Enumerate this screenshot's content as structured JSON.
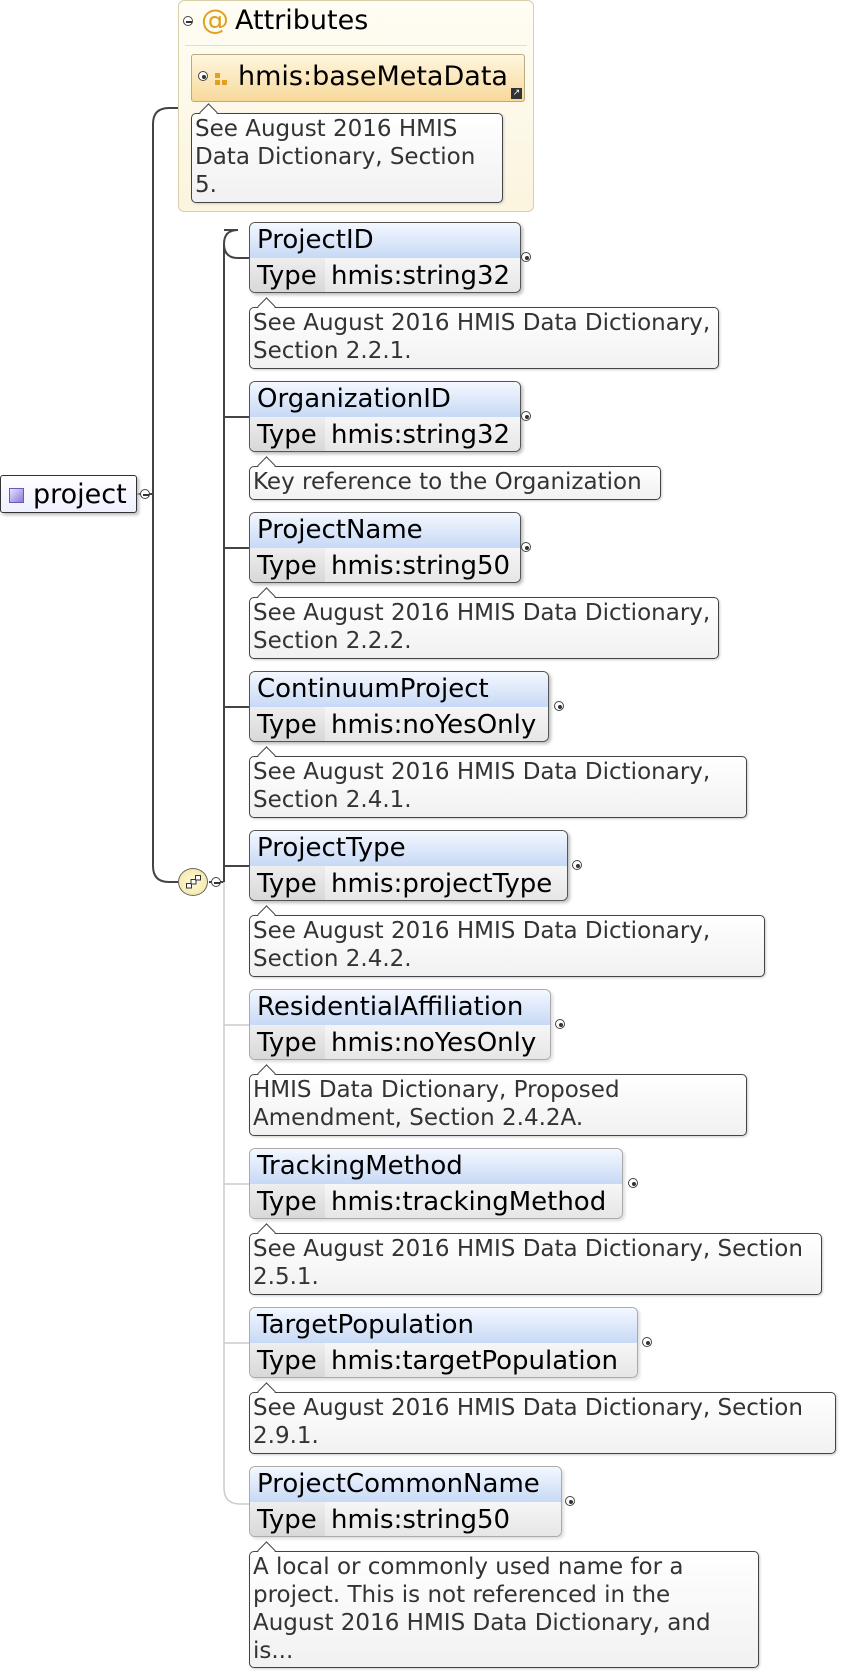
{
  "root": {
    "label": "project"
  },
  "attributes": {
    "symbol": "@",
    "title": "Attributes",
    "group": {
      "label": "hmis:baseMetaData",
      "doc": "See August 2016 HMIS Data Dictionary, Section 5."
    }
  },
  "type_key": "Type",
  "elements": [
    {
      "name": "ProjectID",
      "type": "hmis:string32",
      "doc": "See August 2016 HMIS Data Dictionary, Section 2.2.1."
    },
    {
      "name": "OrganizationID",
      "type": "hmis:string32",
      "doc": "Key reference to the Organization"
    },
    {
      "name": "ProjectName",
      "type": "hmis:string50",
      "doc": "See August 2016 HMIS Data Dictionary, Section 2.2.2."
    },
    {
      "name": "ContinuumProject",
      "type": "hmis:noYesOnly",
      "doc": "See August 2016 HMIS Data Dictionary, Section 2.4.1."
    },
    {
      "name": "ProjectType",
      "type": "hmis:projectType",
      "doc": "See August 2016 HMIS Data Dictionary, Section 2.4.2."
    },
    {
      "name": "ResidentialAffiliation",
      "type": "hmis:noYesOnly",
      "doc": "HMIS Data Dictionary, Proposed Amendment, Section 2.4.2A."
    },
    {
      "name": "TrackingMethod",
      "type": "hmis:trackingMethod",
      "doc": "See August 2016 HMIS Data Dictionary, Section 2.5.1."
    },
    {
      "name": "TargetPopulation",
      "type": "hmis:targetPopulation",
      "doc": "See August 2016 HMIS Data Dictionary, Section 2.9.1."
    },
    {
      "name": "ProjectCommonName",
      "type": "hmis:string50",
      "doc": "A local or commonly used name for a project. This is not referenced in the August 2016 HMIS Data Dictionary, and is..."
    }
  ]
}
